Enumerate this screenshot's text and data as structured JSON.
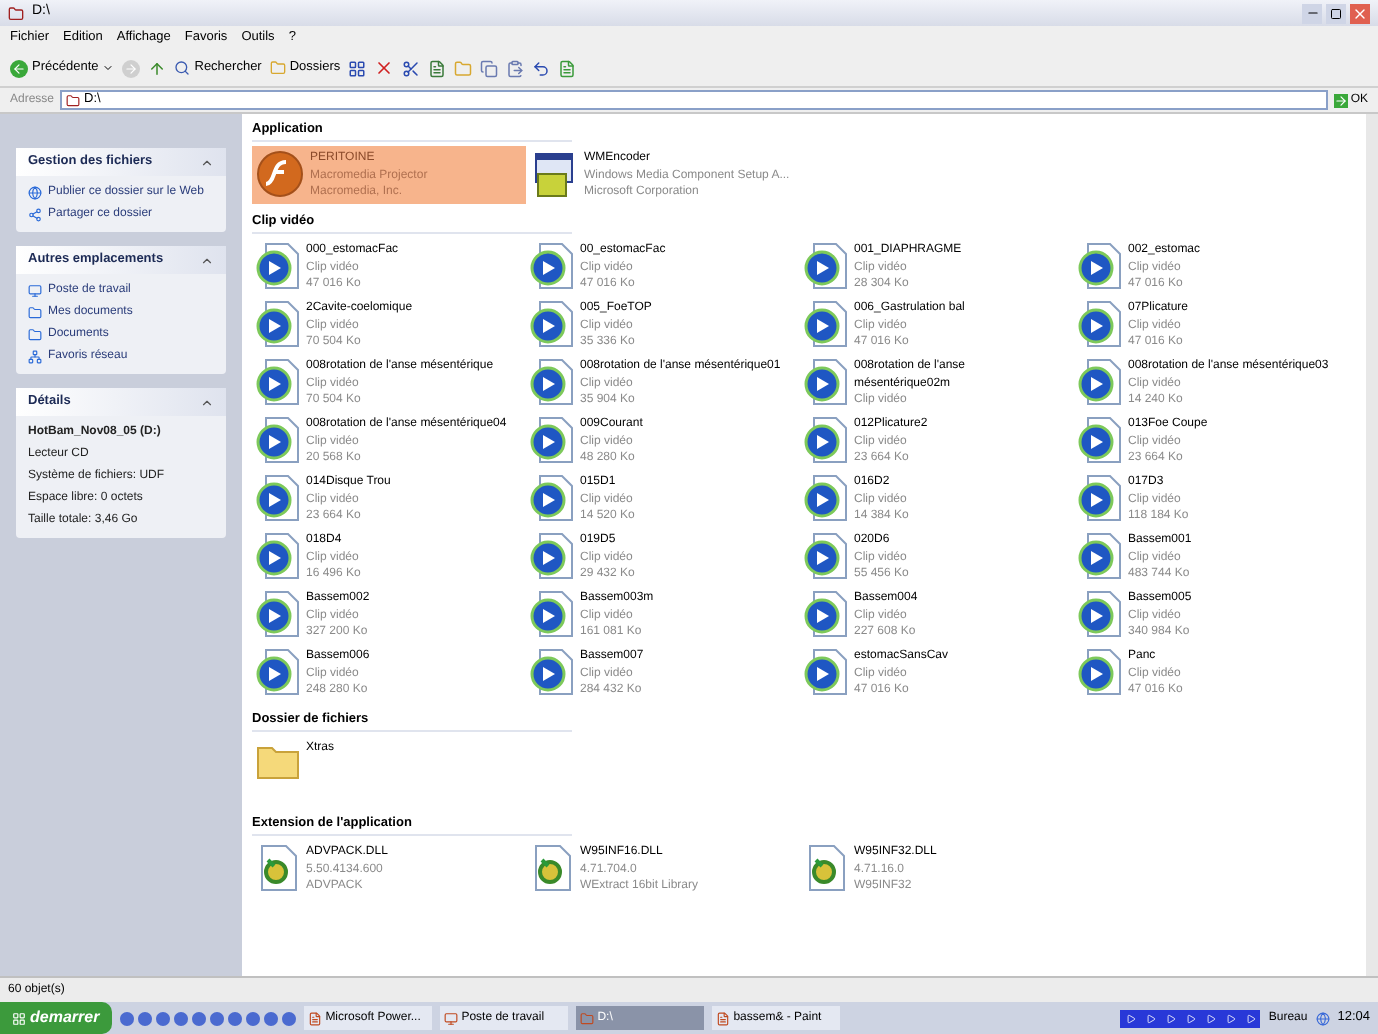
{
  "window": {
    "title": "D:\\"
  },
  "menu": [
    "Fichier",
    "Edition",
    "Affichage",
    "Favoris",
    "Outils",
    "?"
  ],
  "toolbar": {
    "back": "Précédente",
    "search": "Rechercher",
    "folders": "Dossiers"
  },
  "address": {
    "label": "Adresse",
    "value": "D:\\",
    "go": "OK"
  },
  "sidebar": [
    {
      "title": "Gestion des fichiers",
      "kind": "links",
      "items": [
        {
          "label": "Publier ce dossier sur le Web"
        },
        {
          "label": "Partager ce dossier"
        }
      ]
    },
    {
      "title": "Autres emplacements",
      "kind": "links",
      "items": [
        {
          "label": "Poste de travail"
        },
        {
          "label": "Mes documents"
        },
        {
          "label": "Documents"
        },
        {
          "label": "Favoris réseau"
        }
      ]
    },
    {
      "title": "Détails",
      "kind": "details",
      "name": "HotBam_Nov08_05 (D:)",
      "lines": [
        "Lecteur CD",
        "Système de fichiers: UDF",
        "Espace libre: 0 octets",
        "Taille totale: 3,46 Go"
      ]
    }
  ],
  "groups": [
    {
      "title": "Application",
      "items": [
        {
          "kind": "flash",
          "name": "PERITOINE",
          "lines": [
            "Macromedia Projector",
            "Macromedia, Inc."
          ],
          "selected": true
        },
        {
          "kind": "installer",
          "name": "WMEncoder",
          "lines": [
            "Windows Media Component Setup A...",
            "Microsoft Corporation"
          ],
          "selected": false
        }
      ]
    },
    {
      "title": "Clip vidéo",
      "items": [
        {
          "kind": "video",
          "name": "000_estomacFac",
          "lines": [
            "Clip vidéo",
            "47 016 Ko"
          ],
          "selected": false
        },
        {
          "kind": "video",
          "name": "00_estomacFac",
          "lines": [
            "Clip vidéo",
            "47 016 Ko"
          ],
          "selected": false
        },
        {
          "kind": "video",
          "name": "001_DIAPHRAGME",
          "lines": [
            "Clip vidéo",
            "28 304 Ko"
          ],
          "selected": false
        },
        {
          "kind": "video",
          "name": "002_estomac",
          "lines": [
            "Clip vidéo",
            "47 016 Ko"
          ],
          "selected": false
        },
        {
          "kind": "video",
          "name": "2Cavite-coelomique",
          "lines": [
            "Clip vidéo",
            "70 504 Ko"
          ],
          "selected": false
        },
        {
          "kind": "video",
          "name": "005_FoeTOP",
          "lines": [
            "Clip vidéo",
            "35 336 Ko"
          ],
          "selected": false
        },
        {
          "kind": "video",
          "name": "006_Gastrulation bal",
          "lines": [
            "Clip vidéo",
            "47 016 Ko"
          ],
          "selected": false
        },
        {
          "kind": "video",
          "name": "07Plicature",
          "lines": [
            "Clip vidéo",
            "47 016 Ko"
          ],
          "selected": false
        },
        {
          "kind": "video",
          "name": "008rotation de l'anse mésentérique",
          "lines": [
            "Clip vidéo",
            "70 504 Ko"
          ],
          "selected": false
        },
        {
          "kind": "video",
          "name": "008rotation de l'anse mésentérique01",
          "lines": [
            "Clip vidéo",
            "35 904 Ko"
          ],
          "selected": false
        },
        {
          "kind": "video",
          "name_lines": [
            "008rotation de l'anse",
            "mésentérique02m"
          ],
          "lines": [
            "Clip vidéo"
          ],
          "selected": false
        },
        {
          "kind": "video",
          "name": "008rotation de l'anse mésentérique03",
          "lines": [
            "Clip vidéo",
            "14 240 Ko"
          ],
          "selected": false
        },
        {
          "kind": "video",
          "name": "008rotation de l'anse mésentérique04",
          "lines": [
            "Clip vidéo",
            "20 568 Ko"
          ],
          "selected": false
        },
        {
          "kind": "video",
          "name": "009Courant",
          "lines": [
            "Clip vidéo",
            "48 280 Ko"
          ],
          "selected": false
        },
        {
          "kind": "video",
          "name": "012Plicature2",
          "lines": [
            "Clip vidéo",
            "23 664 Ko"
          ],
          "selected": false
        },
        {
          "kind": "video",
          "name": "013Foe Coupe",
          "lines": [
            "Clip vidéo",
            "23 664 Ko"
          ],
          "selected": false
        },
        {
          "kind": "video",
          "name": "014Disque Trou",
          "lines": [
            "Clip vidéo",
            "23 664 Ko"
          ],
          "selected": false
        },
        {
          "kind": "video",
          "name": "015D1",
          "lines": [
            "Clip vidéo",
            "14 520 Ko"
          ],
          "selected": false
        },
        {
          "kind": "video",
          "name": "016D2",
          "lines": [
            "Clip vidéo",
            "14 384 Ko"
          ],
          "selected": false
        },
        {
          "kind": "video",
          "name": "017D3",
          "lines": [
            "Clip vidéo",
            "118 184 Ko"
          ],
          "selected": false
        },
        {
          "kind": "video",
          "name": "018D4",
          "lines": [
            "Clip vidéo",
            "16 496 Ko"
          ],
          "selected": false
        },
        {
          "kind": "video",
          "name": "019D5",
          "lines": [
            "Clip vidéo",
            "29 432 Ko"
          ],
          "selected": false
        },
        {
          "kind": "video",
          "name": "020D6",
          "lines": [
            "Clip vidéo",
            "55 456 Ko"
          ],
          "selected": false
        },
        {
          "kind": "video",
          "name": "Bassem001",
          "lines": [
            "Clip vidéo",
            "483 744 Ko"
          ],
          "selected": false
        },
        {
          "kind": "video",
          "name": "Bassem002",
          "lines": [
            "Clip vidéo",
            "327 200 Ko"
          ],
          "selected": false
        },
        {
          "kind": "video",
          "name": "Bassem003m",
          "lines": [
            "Clip vidéo",
            "161 081 Ko"
          ],
          "selected": false
        },
        {
          "kind": "video",
          "name": "Bassem004",
          "lines": [
            "Clip vidéo",
            "227 608 Ko"
          ],
          "selected": false
        },
        {
          "kind": "video",
          "name": "Bassem005",
          "lines": [
            "Clip vidéo",
            "340 984 Ko"
          ],
          "selected": false
        },
        {
          "kind": "video",
          "name": "Bassem006",
          "lines": [
            "Clip vidéo",
            "248 280 Ko"
          ],
          "selected": false
        },
        {
          "kind": "video",
          "name": "Bassem007",
          "lines": [
            "Clip vidéo",
            "284 432 Ko"
          ],
          "selected": false
        },
        {
          "kind": "video",
          "name": "estomacSansCav",
          "lines": [
            "Clip vidéo",
            "47 016 Ko"
          ],
          "selected": false
        },
        {
          "kind": "video",
          "name": "Panc",
          "lines": [
            "Clip vidéo",
            "47 016 Ko"
          ],
          "selected": false
        }
      ]
    },
    {
      "title": "Dossier de fichiers",
      "items": [
        {
          "kind": "folder",
          "name": "Xtras",
          "selected": false
        }
      ]
    },
    {
      "title": "Extension de l'application",
      "items": [
        {
          "kind": "dll",
          "name": "ADVPACK.DLL",
          "lines": [
            "5.50.4134.600",
            "ADVPACK"
          ],
          "selected": false
        },
        {
          "kind": "dll",
          "name": "W95INF16.DLL",
          "lines": [
            "4.71.704.0",
            "WExtract 16bit Library"
          ],
          "selected": false
        },
        {
          "kind": "dll",
          "name": "W95INF32.DLL",
          "lines": [
            "4.71.16.0",
            "W95INF32"
          ],
          "selected": false
        }
      ]
    }
  ],
  "status_bar": "60 objet(s)",
  "taskbar": {
    "start": "demarrer",
    "tasks": [
      {
        "label": "Microsoft Power...",
        "selected": false
      },
      {
        "label": "Poste de travail",
        "selected": false
      },
      {
        "label": "D:\\",
        "selected": true
      },
      {
        "label": "bassem& - Paint",
        "selected": false
      }
    ],
    "toolbar_label": "Bureau",
    "clock": "12:04"
  }
}
